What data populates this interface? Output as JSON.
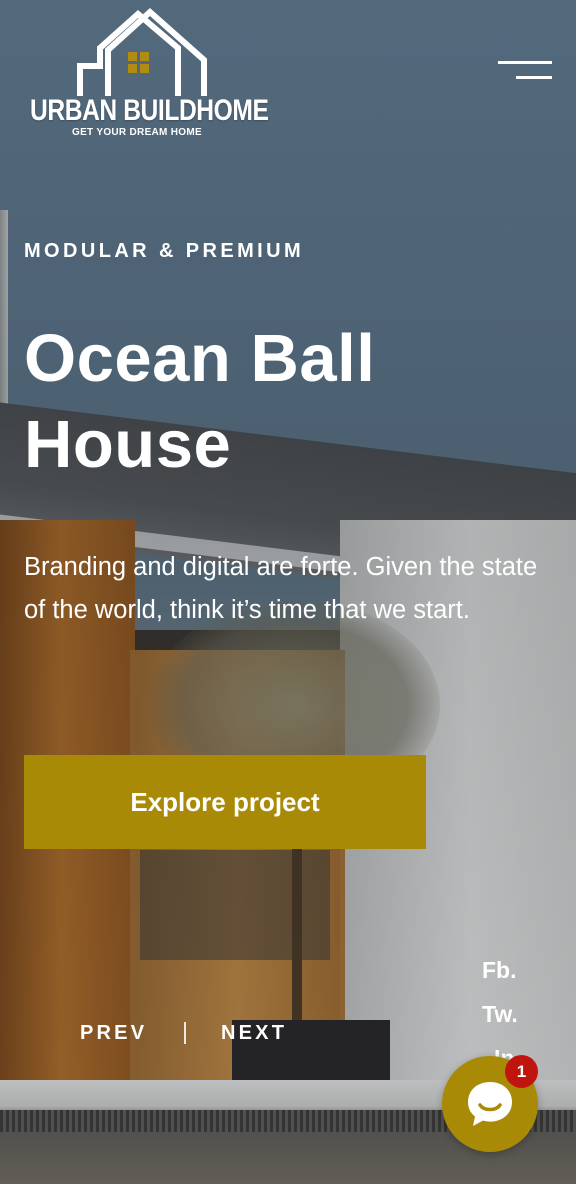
{
  "brand": {
    "name": "URBAN BUILDHOME",
    "tagline": "GET YOUR DREAM HOME",
    "accent_color": "#a98a06"
  },
  "header": {
    "menu_icon": "hamburger-menu-icon"
  },
  "hero": {
    "eyebrow": "MODULAR & PREMIUM",
    "title_line1": "Ocean Ball",
    "title_line2": "House",
    "description": "Branding and digital are forte. Given the state of the world, think it’s time that we start.",
    "cta_label": "Explore project"
  },
  "pager": {
    "prev_label": "PREV",
    "next_label": "NEXT"
  },
  "social": [
    {
      "label": "Fb."
    },
    {
      "label": "Tw."
    },
    {
      "label": "In."
    }
  ],
  "chat": {
    "icon": "chat-bubble-icon",
    "badge_count": "1",
    "badge_color": "#c0150f"
  }
}
